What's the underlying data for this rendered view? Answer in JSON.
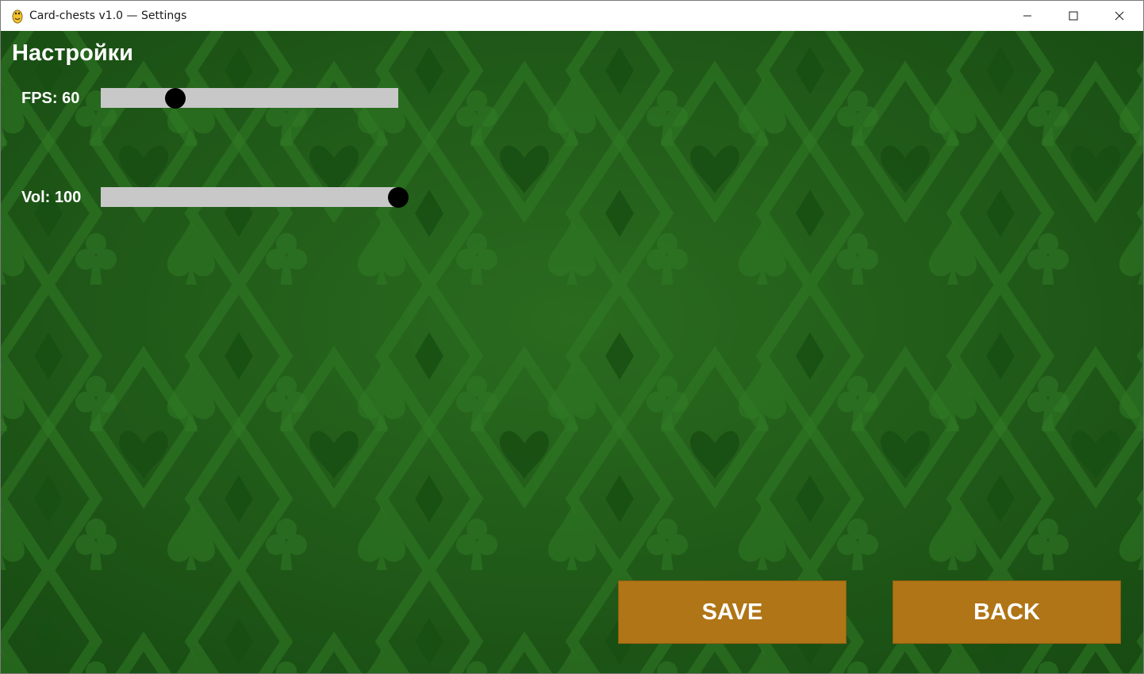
{
  "window": {
    "title": "Card-chests v1.0 — Settings",
    "icon": "pygame-snake-icon",
    "controls": [
      "minimize-icon",
      "maximize-icon",
      "close-icon"
    ]
  },
  "settings": {
    "title": "Настройки",
    "fps": {
      "label": "FPS: 60",
      "value": 60,
      "fraction": 0.25
    },
    "volume": {
      "label": "Vol: 100",
      "value": 100,
      "fraction": 1.0
    }
  },
  "buttons": {
    "save": "SAVE",
    "back": "BACK"
  },
  "colors": {
    "felt": "#1e5a17",
    "button": "#b07516",
    "track": "#c8c8c8",
    "knob": "#000000"
  }
}
